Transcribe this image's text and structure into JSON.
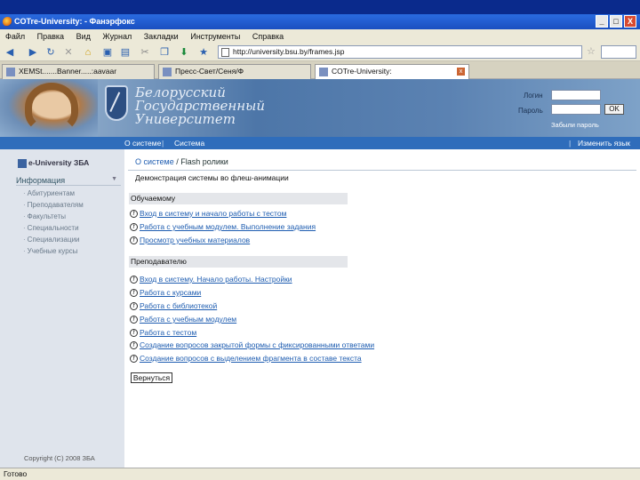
{
  "window": {
    "title": "COTre-University: - Фанэрфокс",
    "buttons": [
      "_",
      "□",
      "X"
    ]
  },
  "menu": [
    "Файл",
    "Правка",
    "Вид",
    "Журнал",
    "Закладки",
    "Инструменты",
    "Справка"
  ],
  "url": "http://university.bsu.by/frames.jsp",
  "tabs": [
    {
      "label": "XEMSt.......Banner.....:aavaar",
      "active": false
    },
    {
      "label": "Пресс-Свет/Сеня/Ф",
      "active": false
    },
    {
      "label": "COTre-University:",
      "active": true
    }
  ],
  "header": {
    "university_lines": [
      "Белорусский",
      "Государственный",
      "Университет"
    ],
    "login_label": "Логин",
    "password_label": "Пароль",
    "ok_label": "OK",
    "forgot_label": "Забыли пароль"
  },
  "bluebar": {
    "items": [
      "О системе",
      "Система"
    ],
    "right_link": "Изменить язык"
  },
  "sidebar": {
    "logo": "e-University ЗБА",
    "heading": "Информация",
    "items": [
      "Абитуриентам",
      "Преподавателям",
      "Факультеты",
      "Специальности",
      "Специализации",
      "Учебные курсы"
    ],
    "copyright": "Copyright (C) 2008 ЗБА"
  },
  "content": {
    "breadcrumb_link": "О системе",
    "breadcrumb_rest": " / Flash ролики",
    "subtitle": "Демонстрация системы во флеш-анимации",
    "sections": [
      {
        "title": "Обучаемому",
        "links": [
          "Вход в систему и начало работы с тестом",
          "Работа с учебным модулем. Выполнение задания",
          "Просмотр учебных материалов"
        ]
      },
      {
        "title": "Преподавателю",
        "links": [
          "Вход в систему. Начало работы. Настройки",
          "Работа с курсами",
          "Работа с библиотекой",
          "Работа с учебным модулем",
          "Работа с тестом",
          "Создание вопросов закрытой формы с фиксированными ответами",
          "Создание вопросов с выделением фрагмента в составе текста"
        ]
      }
    ],
    "back_label": "Вернуться"
  },
  "status": "Готово"
}
